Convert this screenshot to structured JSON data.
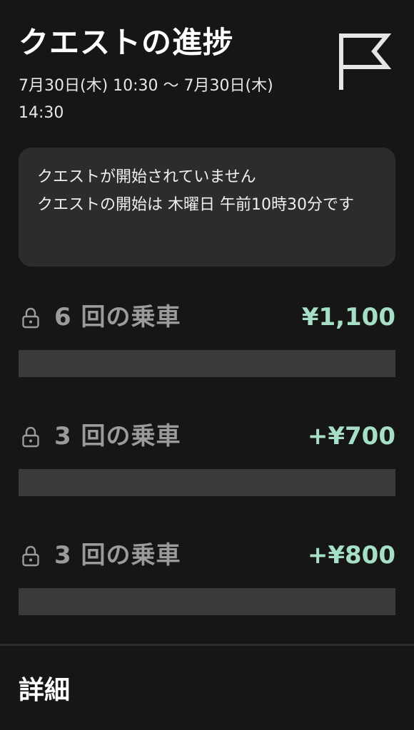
{
  "header": {
    "title": "クエストの進捗",
    "date_range": "7月30日(木) 10:30 〜 7月30日(木) 14:30",
    "flag_icon": "flag-icon"
  },
  "notice": {
    "line1": "クエストが開始されていません",
    "line2": "クエストの開始は 木曜日 午前10時30分です"
  },
  "tiers": [
    {
      "label": "6 回の乗車",
      "reward": "¥1,100",
      "progress": 0,
      "icon": "lock-icon"
    },
    {
      "label": "3 回の乗車",
      "reward": "+¥700",
      "progress": 0,
      "icon": "lock-icon"
    },
    {
      "label": "3 回の乗車",
      "reward": "+¥800",
      "progress": 0,
      "icon": "lock-icon"
    }
  ],
  "details": {
    "label": "詳細"
  },
  "colors": {
    "background": "#161616",
    "card": "#2c2c2c",
    "reward": "#a6dfc5",
    "label": "#9b9b9b",
    "track": "#3a3a3a"
  }
}
